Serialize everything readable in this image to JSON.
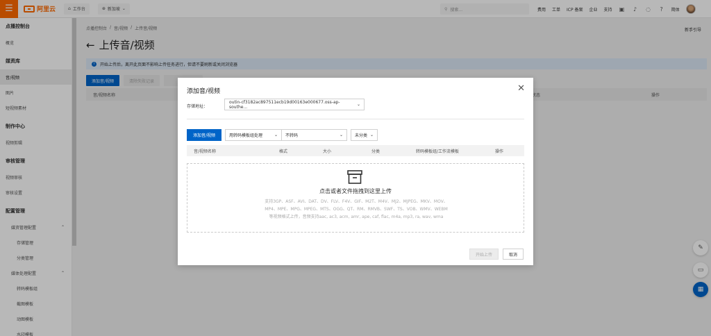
{
  "topbar": {
    "logo_text": "阿里云",
    "workbench": "工作台",
    "region": "新加坡",
    "search_placeholder": "搜索...",
    "links": [
      "费用",
      "工单",
      "ICP 备案",
      "企业",
      "支持"
    ],
    "lang": "简体"
  },
  "sidebar": {
    "title": "点播控制台",
    "overview": "概览",
    "media_group": "媒资库",
    "audio_video": "音/视频",
    "images": "图片",
    "short_video": "短视频素材",
    "production_group": "制作中心",
    "video_editing": "视频剪辑",
    "review_group": "审核管理",
    "video_review": "视频审核",
    "review_settings": "审核设置",
    "config_group": "配置管理",
    "media_config": "媒资管理配置",
    "storage_mgmt": "存储管理",
    "category_mgmt": "分类管理",
    "processing_config": "媒体处理配置",
    "transcode_template": "转码模板组",
    "snapshot_template": "截图模板",
    "animated_template": "动图模板",
    "watermark": "水印模板"
  },
  "main": {
    "breadcrumbs": [
      "点播控制台",
      "/",
      "音/视频",
      "/",
      "上传音/视频"
    ],
    "newbie": "新手引导",
    "title": "上传音/视频",
    "notice": "开始上传后，离开此页面不影响上传任务进行，但请不要刷新或关闭浏览器",
    "add_button": "添加音/视频",
    "clear_button": "清除失败记录",
    "col_name": "音/视频名称",
    "col_status": "状态",
    "col_actions": "操作"
  },
  "modal": {
    "title": "添加音/视频",
    "storage_label": "存储地址：",
    "storage_value": "outin-cf3182ac897511ecb19d00163e000677.oss-ap-southe...",
    "add_button": "添加音/视频",
    "transcode_mode": "用转码模板组处理",
    "transcode_value": "不转码",
    "category": "未分类",
    "columns": [
      "音/视频名称",
      "格式",
      "大小",
      "分类",
      "转码模板组/工作流模板",
      "操作"
    ],
    "drop_text": "点击或者文件拖拽到这里上传",
    "formats": "支持3GP、ASF、AVI、DAT、DV、FLV、F4V、GIF、M2T、M4V、MJ2、MJPEG、MKV、MOV、MP4、MPE、MPG、MPEG、MTS、OGG、QT、RM、RMVB、SWF、TS、VOB、WMV、WEBM 等视频格式上传，音频支持aac, ac3, acm, amr, ape, caf, flac, m4a, mp3, ra, wav, wma",
    "start_upload": "开始上传",
    "cancel": "取消"
  }
}
